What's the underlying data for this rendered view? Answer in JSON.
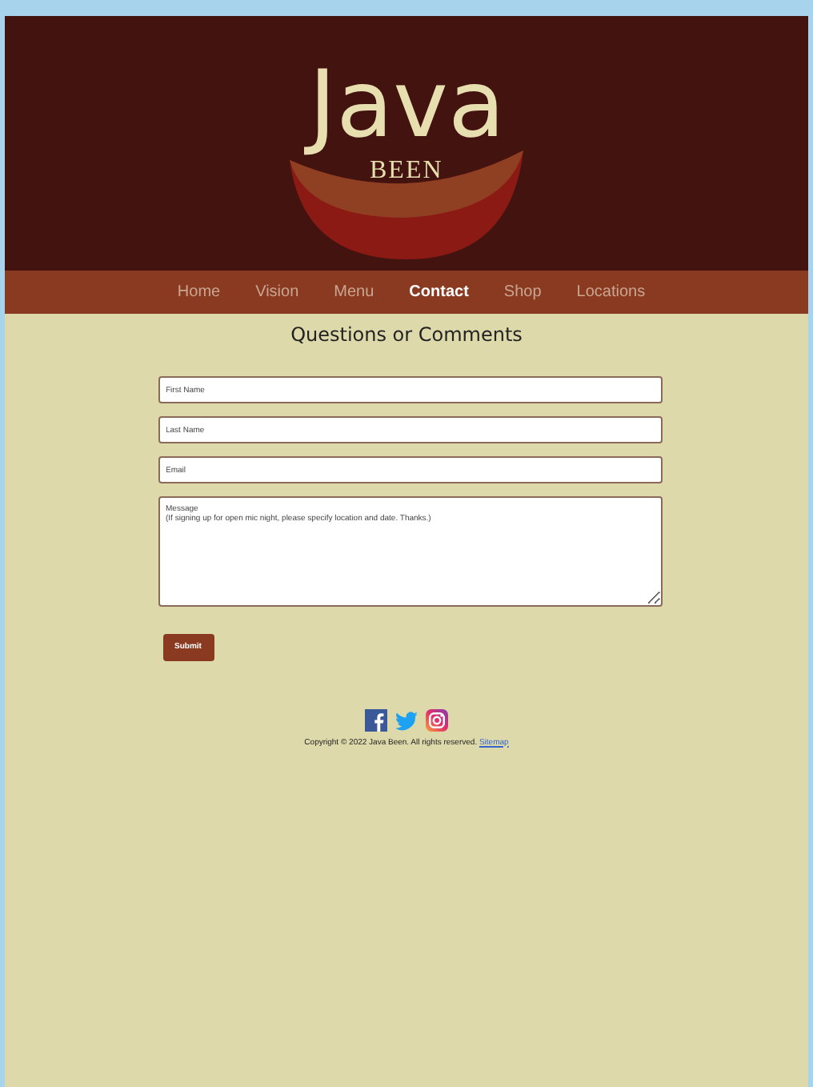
{
  "logo": {
    "word": "Java",
    "subword": "BEEN"
  },
  "nav": [
    {
      "label": "Home",
      "selected": false
    },
    {
      "label": "Vision",
      "selected": false
    },
    {
      "label": "Menu",
      "selected": false
    },
    {
      "label": "Contact",
      "selected": true
    },
    {
      "label": "Shop",
      "selected": false
    },
    {
      "label": "Locations",
      "selected": false
    }
  ],
  "heading": "Questions or Comments",
  "form": {
    "fields": [
      {
        "kind": "input",
        "placeholder": "First Name"
      },
      {
        "kind": "input",
        "placeholder": "Last Name"
      },
      {
        "kind": "input",
        "placeholder": "Email"
      },
      {
        "kind": "textarea",
        "placeholder": "Message\n(If signing up for open mic night, please specify location and date. Thanks.)"
      }
    ],
    "submit": "Submit"
  },
  "social": [
    {
      "kind": "facebook"
    },
    {
      "kind": "twitter"
    },
    {
      "kind": "instagram"
    }
  ],
  "footer": {
    "copyright": "Copyright © 2022 Java Been. All rights reserved.",
    "link": "Sitemap"
  }
}
